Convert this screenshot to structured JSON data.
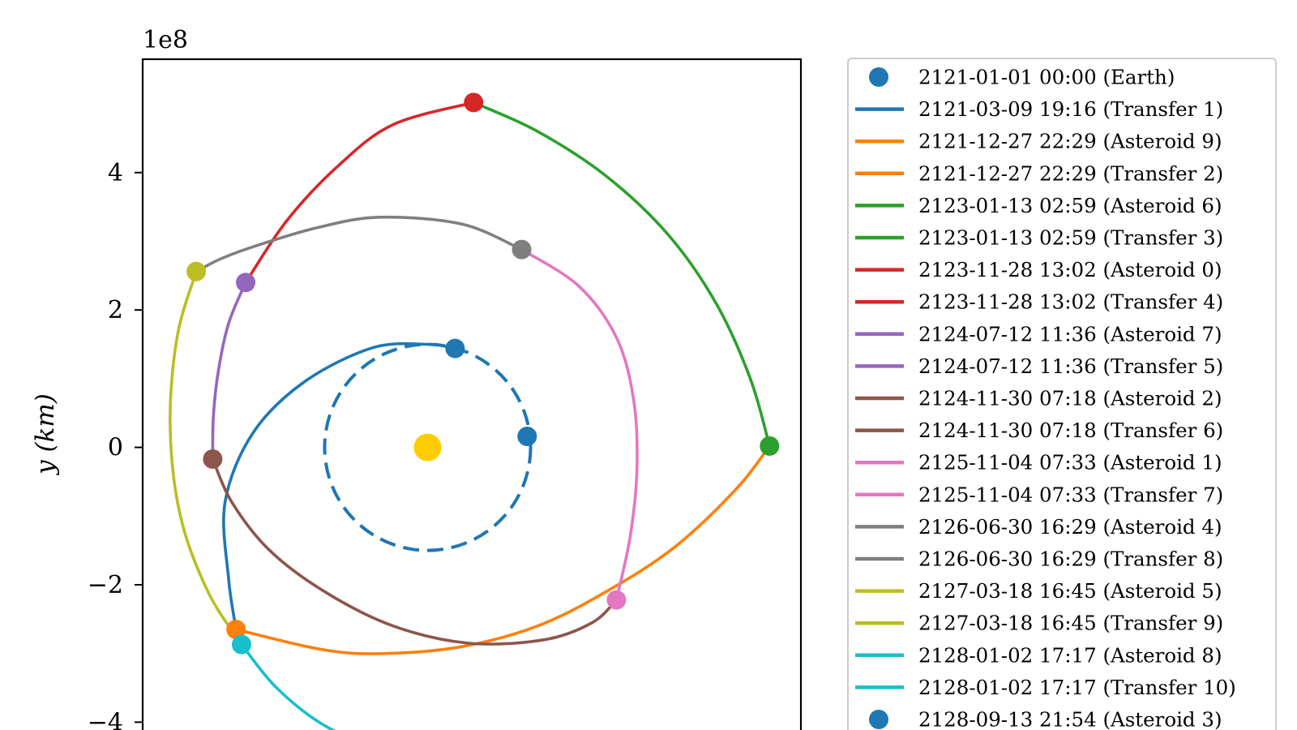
{
  "chart_data": {
    "type": "line",
    "title": "",
    "xlabel": "",
    "ylabel": "y (km)",
    "offset_label": "1e8",
    "xlim": [
      -4.15,
      5.45
    ],
    "ylim": [
      -4.3,
      5.65
    ],
    "y_ticks": [
      4,
      2,
      0,
      -2,
      -4
    ],
    "y_tick_labels": [
      "4",
      "2",
      "0",
      "−2",
      "−4"
    ],
    "grid": false,
    "legend_placement": "outside-right",
    "sun": {
      "x": 0.0,
      "y": 0.0,
      "color": "#ffcc00"
    },
    "earth_orbit": {
      "radius": 1.5,
      "style": "dashed",
      "color": "#1f77b4"
    },
    "bodies": [
      {
        "name": "Earth",
        "x": 1.45,
        "y": 0.16,
        "color": "#1f77b4"
      },
      {
        "name": "Asteroid 9",
        "x": -2.79,
        "y": -2.65,
        "color": "#ff7f0e"
      },
      {
        "name": "Asteroid 6",
        "x": 4.98,
        "y": 0.02,
        "color": "#2ca02c"
      },
      {
        "name": "Asteroid 0",
        "x": 0.67,
        "y": 5.02,
        "color": "#d62728"
      },
      {
        "name": "Asteroid 7",
        "x": -2.65,
        "y": 2.4,
        "color": "#9467bd"
      },
      {
        "name": "Asteroid 2",
        "x": -3.13,
        "y": -0.17,
        "color": "#8c564b"
      },
      {
        "name": "Asteroid 1",
        "x": 2.75,
        "y": -2.22,
        "color": "#e377c2"
      },
      {
        "name": "Asteroid 4",
        "x": 1.37,
        "y": 2.88,
        "color": "#7f7f7f"
      },
      {
        "name": "Asteroid 5",
        "x": -3.37,
        "y": 2.56,
        "color": "#bcbd22"
      },
      {
        "name": "Asteroid 8",
        "x": -2.71,
        "y": -2.87,
        "color": "#17becf"
      },
      {
        "name": "Asteroid 3",
        "x": 0.4,
        "y": 1.44,
        "color": "#1f77b4"
      }
    ],
    "series": [
      {
        "name": "Transfer 1",
        "color": "#1f77b4",
        "x": [
          0.4,
          0.0,
          -0.8,
          -1.8,
          -2.55,
          -2.95,
          -2.9,
          -2.79
        ],
        "y": [
          1.44,
          1.5,
          1.45,
          0.95,
          0.2,
          -0.8,
          -1.9,
          -2.65
        ]
      },
      {
        "name": "Transfer 2",
        "color": "#ff7f0e",
        "x": [
          -2.79,
          -1.5,
          -0.6,
          0.5,
          1.6,
          2.6,
          3.6,
          4.5,
          4.98
        ],
        "y": [
          -2.65,
          -2.95,
          -3.0,
          -2.9,
          -2.6,
          -2.1,
          -1.45,
          -0.6,
          0.02
        ]
      },
      {
        "name": "Transfer 3",
        "color": "#2ca02c",
        "x": [
          4.98,
          4.7,
          4.2,
          3.5,
          2.6,
          1.6,
          0.67
        ],
        "y": [
          0.02,
          1.0,
          2.1,
          3.1,
          3.95,
          4.6,
          5.02
        ]
      },
      {
        "name": "Transfer 4",
        "color": "#d62728",
        "x": [
          0.67,
          -0.5,
          -1.3,
          -2.05,
          -2.65
        ],
        "y": [
          5.02,
          4.7,
          4.1,
          3.3,
          2.4
        ]
      },
      {
        "name": "Transfer 5",
        "color": "#9467bd",
        "x": [
          -2.65,
          -2.9,
          -3.05,
          -3.12,
          -3.13
        ],
        "y": [
          2.4,
          1.8,
          1.1,
          0.45,
          -0.17
        ]
      },
      {
        "name": "Transfer 6",
        "color": "#8c564b",
        "x": [
          -3.13,
          -2.85,
          -2.3,
          -1.5,
          -0.5,
          0.6,
          1.7,
          2.4,
          2.75
        ],
        "y": [
          -0.17,
          -0.8,
          -1.5,
          -2.1,
          -2.6,
          -2.85,
          -2.8,
          -2.55,
          -2.22
        ]
      },
      {
        "name": "Transfer 7",
        "color": "#e377c2",
        "x": [
          2.75,
          2.95,
          3.05,
          3.0,
          2.75,
          2.2,
          1.37
        ],
        "y": [
          -2.22,
          -1.3,
          -0.3,
          0.7,
          1.6,
          2.35,
          2.88
        ]
      },
      {
        "name": "Transfer 8",
        "color": "#7f7f7f",
        "x": [
          1.37,
          0.5,
          -0.7,
          -1.6,
          -2.45,
          -3.0,
          -3.37
        ],
        "y": [
          2.88,
          3.25,
          3.35,
          3.2,
          2.95,
          2.75,
          2.56
        ]
      },
      {
        "name": "Transfer 9",
        "color": "#bcbd22",
        "x": [
          -3.37,
          -3.65,
          -3.75,
          -3.6,
          -3.2,
          -2.71
        ],
        "y": [
          2.56,
          1.6,
          0.3,
          -1.0,
          -2.1,
          -2.87
        ]
      },
      {
        "name": "Transfer 10",
        "color": "#17becf",
        "x": [
          -2.71,
          -2.2,
          -1.5,
          -0.6
        ],
        "y": [
          -2.87,
          -3.5,
          -4.05,
          -4.45
        ]
      }
    ],
    "legend": [
      {
        "label": "2121-01-01 00:00 (Earth)",
        "marker": "dot",
        "color": "#1f77b4"
      },
      {
        "label": "2121-03-09 19:16 (Transfer 1)",
        "marker": "line",
        "color": "#1f77b4"
      },
      {
        "label": "2121-12-27 22:29 (Asteroid 9)",
        "marker": "line",
        "color": "#ff7f0e"
      },
      {
        "label": "2121-12-27 22:29 (Transfer 2)",
        "marker": "line",
        "color": "#ff7f0e"
      },
      {
        "label": "2123-01-13 02:59 (Asteroid 6)",
        "marker": "line",
        "color": "#2ca02c"
      },
      {
        "label": "2123-01-13 02:59 (Transfer 3)",
        "marker": "line",
        "color": "#2ca02c"
      },
      {
        "label": "2123-11-28 13:02 (Asteroid 0)",
        "marker": "line",
        "color": "#d62728"
      },
      {
        "label": "2123-11-28 13:02 (Transfer 4)",
        "marker": "line",
        "color": "#d62728"
      },
      {
        "label": "2124-07-12 11:36 (Asteroid 7)",
        "marker": "line",
        "color": "#9467bd"
      },
      {
        "label": "2124-07-12 11:36 (Transfer 5)",
        "marker": "line",
        "color": "#9467bd"
      },
      {
        "label": "2124-11-30 07:18 (Asteroid 2)",
        "marker": "line",
        "color": "#8c564b"
      },
      {
        "label": "2124-11-30 07:18 (Transfer 6)",
        "marker": "line",
        "color": "#8c564b"
      },
      {
        "label": "2125-11-04 07:33 (Asteroid 1)",
        "marker": "line",
        "color": "#e377c2"
      },
      {
        "label": "2125-11-04 07:33 (Transfer 7)",
        "marker": "line",
        "color": "#e377c2"
      },
      {
        "label": "2126-06-30 16:29 (Asteroid 4)",
        "marker": "line",
        "color": "#7f7f7f"
      },
      {
        "label": "2126-06-30 16:29 (Transfer 8)",
        "marker": "line",
        "color": "#7f7f7f"
      },
      {
        "label": "2127-03-18 16:45 (Asteroid 5)",
        "marker": "line",
        "color": "#bcbd22"
      },
      {
        "label": "2127-03-18 16:45 (Transfer 9)",
        "marker": "line",
        "color": "#bcbd22"
      },
      {
        "label": "2128-01-02 17:17 (Asteroid 8)",
        "marker": "line",
        "color": "#17becf"
      },
      {
        "label": "2128-01-02 17:17 (Transfer 10)",
        "marker": "line",
        "color": "#17becf"
      },
      {
        "label": "2128-09-13 21:54 (Asteroid 3)",
        "marker": "dot",
        "color": "#1f77b4"
      }
    ]
  }
}
